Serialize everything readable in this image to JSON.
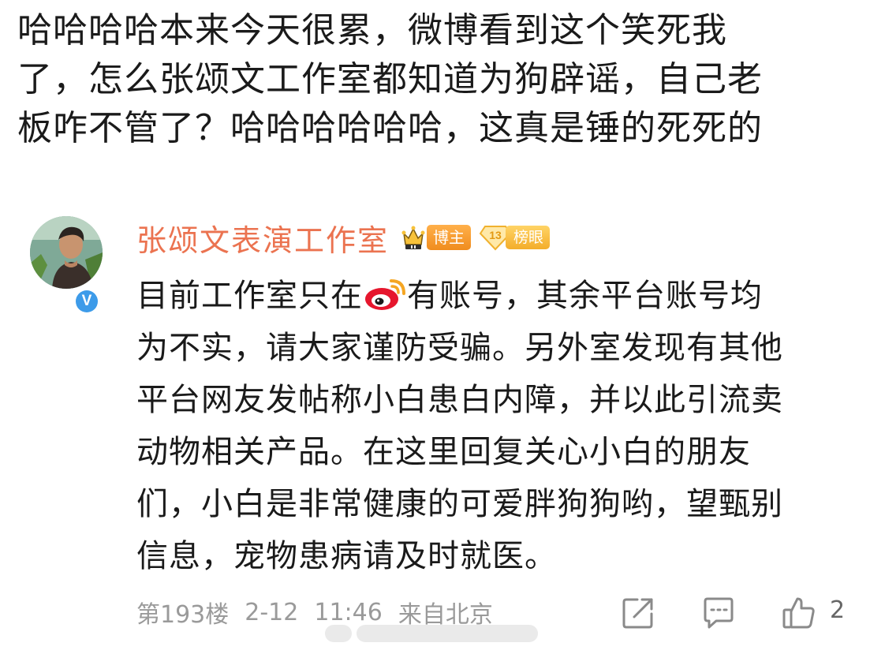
{
  "caption": {
    "lines": [
      "哈哈哈哈本来今天很累，微博看到这个笑死我",
      "了，怎么张颂文工作室都知道为狗辟谣，自己老",
      "板咋不管了？哈哈哈哈哈哈，这真是锤的死死的"
    ]
  },
  "reply": {
    "author": "张颂文表演工作室",
    "badges": {
      "crown_icon": "crown-ii-icon",
      "blogger_label": "博主",
      "rank_number": "13",
      "rank_label": "榜眼"
    },
    "verified_icon": "verified-v-icon",
    "verified_text": "V",
    "body": {
      "line1_before_logo": "目前工作室只在",
      "logo_icon": "weibo-logo-icon",
      "line1_after_logo": "有账号，其余平台账号均",
      "line2": "为不实，请大家谨防受骗。另外室发现有其他",
      "line3": "平台网友发帖称小白患白内障，并以此引流卖",
      "line4": "动物相关产品。在这里回复关心小白的朋友",
      "line5": "们，小白是非常健康的可爱胖狗狗哟，望甄别",
      "line6": "信息，宠物患病请及时就医。"
    },
    "meta": {
      "floor": "第193楼",
      "date": "2-12",
      "time": "11:46",
      "source": "来自北京"
    },
    "actions": {
      "share_icon": "share-icon",
      "comment_icon": "comment-icon",
      "like_icon": "thumbs-up-icon",
      "like_count": "2"
    }
  },
  "colors": {
    "author_name": "#eb7350",
    "blogger_badge": "#f08c1e",
    "rank_badge": "#f3ad2a",
    "verified": "#3d9be9",
    "weibo_red": "#e6162d",
    "meta_text": "#9a9a9a"
  }
}
